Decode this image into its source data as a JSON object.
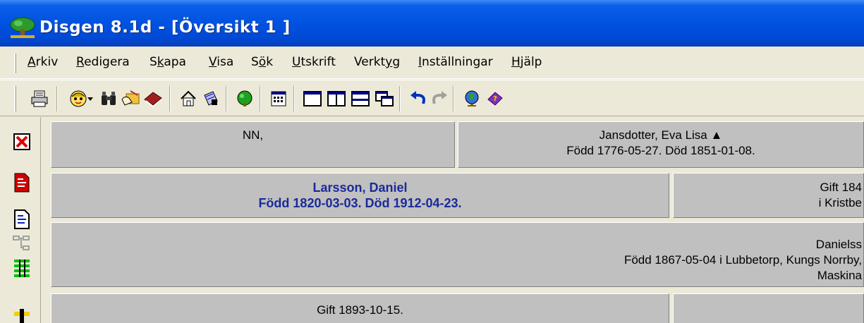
{
  "window": {
    "title": "Disgen 8.1d - [Översikt 1 ]",
    "brand_color": "#0052e0"
  },
  "menu": {
    "items": [
      {
        "label": "Arkiv",
        "underline": "A"
      },
      {
        "label": "Redigera",
        "underline": "R"
      },
      {
        "label": "Skapa",
        "underline": "k"
      },
      {
        "label": "Visa",
        "underline": "V"
      },
      {
        "label": "Sök",
        "underline": "ö"
      },
      {
        "label": "Utskrift",
        "underline": "U"
      },
      {
        "label": "Verktyg",
        "underline": "y"
      },
      {
        "label": "Inställningar",
        "underline": "I"
      },
      {
        "label": "Hjälp",
        "underline": "H"
      }
    ]
  },
  "toolbar": {
    "icons": [
      "printer-icon",
      "person-face-icon",
      "dropdown-arrow-icon",
      "binoculars-icon",
      "hand-folder-icon",
      "book-icon",
      "home-icon",
      "notebook-icon",
      "green-tree-icon",
      "calendar-icon",
      "single-window-icon",
      "two-column-icon",
      "two-row-icon",
      "cascade-window-icon",
      "undo-icon",
      "redo-icon",
      "globe-icon",
      "help-book-icon"
    ]
  },
  "left_toolbar": {
    "icons": [
      "close-red-x-icon",
      "red-document-icon",
      "blue-document-icon",
      "tree-chart-icon",
      "green-list-icon",
      "yellow-cross-icon"
    ]
  },
  "overview": {
    "row1": {
      "left": {
        "name": "NN,"
      },
      "right": {
        "name": "Jansdotter, Eva Lisa ▲",
        "dates": "Född 1776-05-27. Död 1851-01-08."
      }
    },
    "row2": {
      "main": {
        "name": "Larsson, Daniel",
        "dates": "Född 1820-03-03. Död 1912-04-23."
      },
      "right": {
        "line1": "Gift 184",
        "line2": "i Kristbe"
      }
    },
    "row3": {
      "line1": "Danielss",
      "line2": "Född 1867-05-04 i Lubbetorp, Kungs Norrby,",
      "line3": "Maskina"
    },
    "row4": {
      "left": {
        "text": "Gift 1893-10-15."
      }
    }
  },
  "colors": {
    "highlight_text": "#1a2a9a",
    "box_bg": "#c0c0c0",
    "window_bg": "#ece9d8"
  }
}
